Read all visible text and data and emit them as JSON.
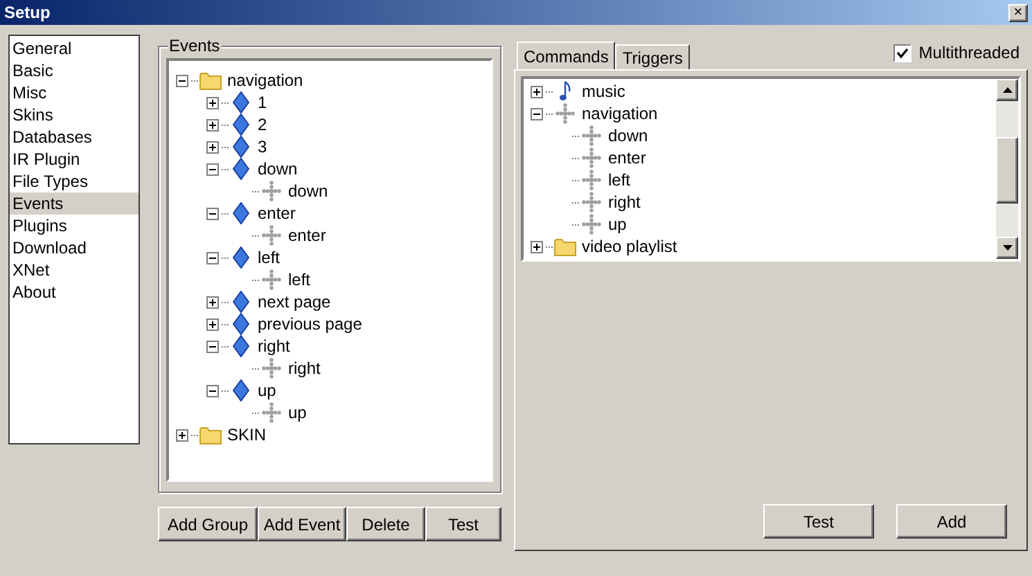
{
  "window": {
    "title": "Setup",
    "close": "×"
  },
  "sidebar": {
    "items": [
      {
        "label": "General",
        "selected": false
      },
      {
        "label": "Basic",
        "selected": false
      },
      {
        "label": "Misc",
        "selected": false
      },
      {
        "label": "Skins",
        "selected": false
      },
      {
        "label": "Databases",
        "selected": false
      },
      {
        "label": "IR Plugin",
        "selected": false
      },
      {
        "label": "File Types",
        "selected": false
      },
      {
        "label": "Events",
        "selected": true
      },
      {
        "label": "Plugins",
        "selected": false
      },
      {
        "label": "Download",
        "selected": false
      },
      {
        "label": "XNet",
        "selected": false
      },
      {
        "label": "About",
        "selected": false
      }
    ]
  },
  "events": {
    "title": "Events",
    "tree": [
      {
        "label": "navigation",
        "kind": "folder",
        "expanded": true,
        "children": [
          {
            "label": "1",
            "kind": "event",
            "expanded": false
          },
          {
            "label": "2",
            "kind": "event",
            "expanded": false
          },
          {
            "label": "3",
            "kind": "event",
            "expanded": false
          },
          {
            "label": "down",
            "kind": "event",
            "expanded": true,
            "children": [
              {
                "label": "down",
                "kind": "command"
              }
            ]
          },
          {
            "label": "enter",
            "kind": "event",
            "expanded": true,
            "children": [
              {
                "label": "enter",
                "kind": "command"
              }
            ]
          },
          {
            "label": "left",
            "kind": "event",
            "expanded": true,
            "children": [
              {
                "label": "left",
                "kind": "command"
              }
            ]
          },
          {
            "label": "next page",
            "kind": "event",
            "expanded": false
          },
          {
            "label": "previous page",
            "kind": "event",
            "expanded": false
          },
          {
            "label": "right",
            "kind": "event",
            "expanded": true,
            "children": [
              {
                "label": "right",
                "kind": "command"
              }
            ]
          },
          {
            "label": "up",
            "kind": "event",
            "expanded": true,
            "children": [
              {
                "label": "up",
                "kind": "command"
              }
            ]
          }
        ]
      },
      {
        "label": "SKIN",
        "kind": "folder",
        "expanded": false
      }
    ]
  },
  "event_buttons": [
    "Add Group",
    "Add Event",
    "Delete",
    "Test"
  ],
  "tabs": [
    {
      "label": "Commands",
      "selected": true
    },
    {
      "label": "Triggers",
      "selected": false
    }
  ],
  "multithreaded": {
    "label": "Multithreaded",
    "checked": true
  },
  "commands": {
    "tree": [
      {
        "label": "music",
        "kind": "music",
        "expanded": false
      },
      {
        "label": "navigation",
        "kind": "command",
        "expanded": true,
        "children": [
          {
            "label": "down",
            "kind": "command"
          },
          {
            "label": "enter",
            "kind": "command"
          },
          {
            "label": "left",
            "kind": "command"
          },
          {
            "label": "right",
            "kind": "command"
          },
          {
            "label": "up",
            "kind": "command"
          }
        ]
      },
      {
        "label": "video playlist",
        "kind": "folder",
        "expanded": false
      }
    ]
  },
  "command_buttons": [
    "Test",
    "Add"
  ]
}
